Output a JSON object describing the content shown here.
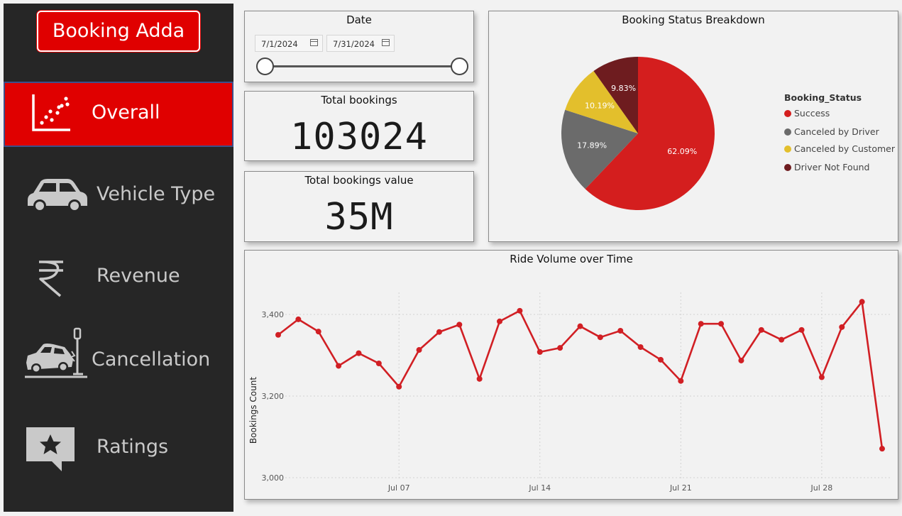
{
  "app": {
    "title": "Booking Adda"
  },
  "sidebar": {
    "items": [
      {
        "label": "Overall",
        "icon": "scatter-chart-icon",
        "active": true
      },
      {
        "label": "Vehicle Type",
        "icon": "car-icon",
        "active": false
      },
      {
        "label": "Revenue",
        "icon": "rupee-icon",
        "active": false
      },
      {
        "label": "Cancellation",
        "icon": "car-crash-icon",
        "active": false
      },
      {
        "label": "Ratings",
        "icon": "star-comment-icon",
        "active": false
      }
    ]
  },
  "date_filter": {
    "title": "Date",
    "start": "7/1/2024",
    "end": "7/31/2024"
  },
  "kpis": {
    "total_bookings": {
      "label": "Total bookings",
      "value": "103024"
    },
    "total_value": {
      "label": "Total bookings value",
      "value": "35M"
    }
  },
  "colors": {
    "accent": "#e00000",
    "sidebar_bg": "#262626",
    "success": "#d41e1e",
    "canceled_driver": "#6b6b6b",
    "canceled_customer": "#e3bf2c",
    "driver_not_found": "#6e1c1f",
    "line": "#d11f24"
  },
  "chart_data": [
    {
      "type": "pie",
      "title": "Booking Status Breakdown",
      "legend_title": "Booking_Status",
      "legend_position": "right",
      "categories": [
        "Success",
        "Canceled by Driver",
        "Canceled by Customer",
        "Driver Not Found"
      ],
      "values": [
        62.09,
        17.89,
        10.19,
        9.83
      ],
      "labels": [
        "62.09%",
        "17.89%",
        "10.19%",
        "9.83%"
      ],
      "colors": [
        "#d41e1e",
        "#6b6b6b",
        "#e3bf2c",
        "#6e1c1f"
      ]
    },
    {
      "type": "line",
      "title": "Ride Volume over Time",
      "ylabel": "Bookings Count",
      "xlabel": "",
      "ylim": [
        3000,
        3470
      ],
      "yticks": [
        3000,
        3200,
        3400
      ],
      "ytick_labels": [
        "3,000",
        "3,200",
        "3,400"
      ],
      "xticks": [
        7,
        14,
        21,
        28
      ],
      "xtick_labels": [
        "Jul 07",
        "Jul 14",
        "Jul 21",
        "Jul 28"
      ],
      "grid": true,
      "x": [
        1,
        2,
        3,
        4,
        5,
        6,
        7,
        8,
        9,
        10,
        11,
        12,
        13,
        14,
        15,
        16,
        17,
        18,
        19,
        20,
        21,
        22,
        23,
        24,
        25,
        26,
        27,
        28,
        29,
        30,
        31
      ],
      "values": [
        3350,
        3388,
        3358,
        3274,
        3305,
        3280,
        3223,
        3313,
        3357,
        3375,
        3242,
        3383,
        3409,
        3308,
        3318,
        3371,
        3344,
        3360,
        3320,
        3289,
        3237,
        3377,
        3377,
        3287,
        3362,
        3338,
        3362,
        3246,
        3369,
        3431,
        3071
      ]
    }
  ]
}
